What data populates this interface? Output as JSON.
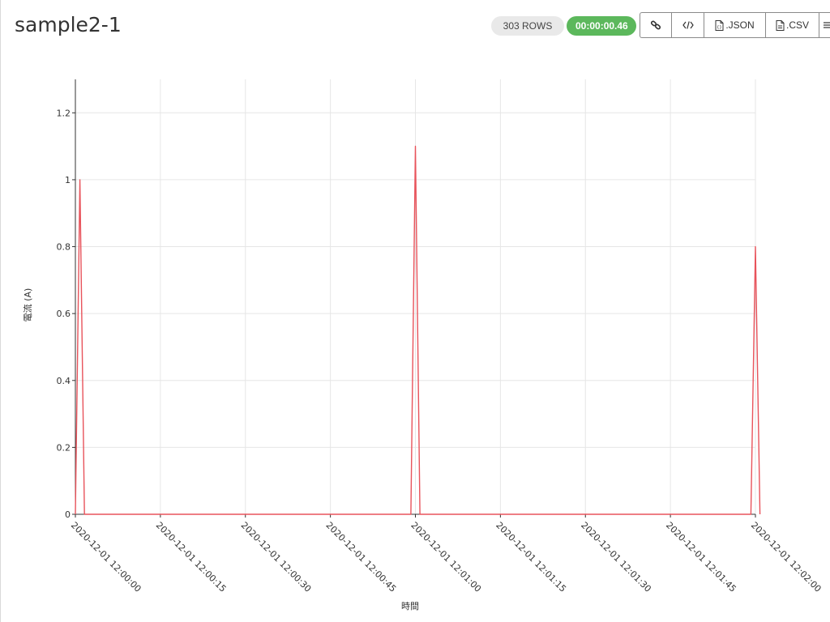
{
  "header": {
    "title": "sample2-1",
    "rows_badge": "303 ROWS",
    "time_badge": "00:00:00.46"
  },
  "toolbar": {
    "link_icon": "link-icon",
    "code_icon": "code-icon",
    "json_label": ".JSON",
    "json_icon": "json-file-icon",
    "csv_label": ".CSV",
    "csv_icon": "csv-file-icon",
    "menu_icon": "menu-icon"
  },
  "colors": {
    "line": "#e8535b",
    "time_badge": "#5cb85c",
    "grid": "#e6e6e6"
  },
  "chart_data": {
    "type": "line",
    "ylabel": "電流 (A)",
    "xlabel": "時間",
    "ylim": [
      0,
      1.3
    ],
    "yticks": [
      0,
      0.2,
      0.4,
      0.6,
      0.8,
      1,
      1.2
    ],
    "xticks": [
      "2020-12-01 12:00:00",
      "2020-12-01 12:00:15",
      "2020-12-01 12:00:30",
      "2020-12-01 12:00:45",
      "2020-12-01 12:01:00",
      "2020-12-01 12:01:15",
      "2020-12-01 12:01:30",
      "2020-12-01 12:01:45",
      "2020-12-01 12:02:00"
    ],
    "xlim": [
      "2020-12-01 12:00:00",
      "2020-12-01 12:02:00"
    ],
    "grid": true,
    "series": [
      {
        "points": [
          [
            "2020-12-01 12:00:00",
            0
          ],
          [
            "2020-12-01 12:00:00.4",
            0.5
          ],
          [
            "2020-12-01 12:00:00.8",
            1.0
          ],
          [
            "2020-12-01 12:00:01.2",
            0.5
          ],
          [
            "2020-12-01 12:00:01.6",
            0
          ],
          [
            "2020-12-01 12:00:59.2",
            0
          ],
          [
            "2020-12-01 12:00:59.6",
            0.55
          ],
          [
            "2020-12-01 12:01:00",
            1.1
          ],
          [
            "2020-12-01 12:01:00.4",
            0.55
          ],
          [
            "2020-12-01 12:01:00.8",
            0
          ],
          [
            "2020-12-01 12:01:59.2",
            0
          ],
          [
            "2020-12-01 12:01:59.6",
            0.4
          ],
          [
            "2020-12-01 12:02:00",
            0.8
          ],
          [
            "2020-12-01 12:02:00.4",
            0.4
          ],
          [
            "2020-12-01 12:02:00.8",
            0
          ]
        ]
      }
    ]
  }
}
